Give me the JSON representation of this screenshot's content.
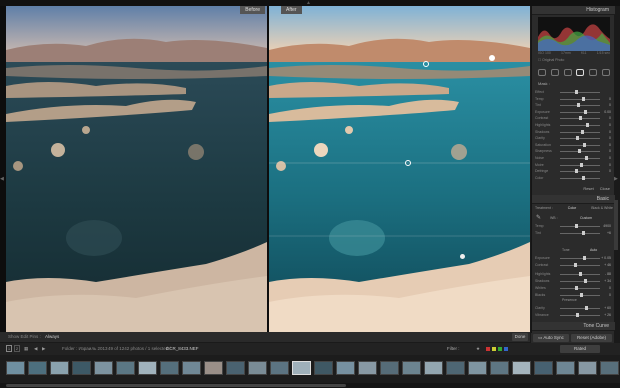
{
  "compare": {
    "before_label": "Before",
    "after_label": "After"
  },
  "panel": {
    "histogram_title": "Histogram",
    "histogram_info": [
      "ISO 100",
      "17mm",
      "f/11",
      "1/15 sec"
    ],
    "original_photo_label": "Original Photo",
    "basic_title": "Basic",
    "treatment": [
      "Treatment :",
      "Color",
      "Black & White"
    ],
    "wb_label": "WB :",
    "wb_value": "Custom",
    "tone_label": "Tone",
    "tone_auto": "Auto",
    "presence_label": "Presence",
    "tone_curve_title": "Tone Curve",
    "mask_title": "Mask :",
    "sliders_top": [
      {
        "label": "Effect",
        "value": ""
      },
      {
        "label": "Temp",
        "value": "0"
      },
      {
        "label": "Tint",
        "value": "0"
      },
      {
        "label": "Exposure",
        "value": "0.00"
      },
      {
        "label": "Contrast",
        "value": "0"
      },
      {
        "label": "Highlights",
        "value": "0"
      },
      {
        "label": "Shadows",
        "value": "0"
      },
      {
        "label": "Clarity",
        "value": "0"
      },
      {
        "label": "Saturation",
        "value": "0"
      },
      {
        "label": "Sharpness",
        "value": "0"
      },
      {
        "label": "Noise",
        "value": "0"
      },
      {
        "label": "Moire",
        "value": "0"
      },
      {
        "label": "Defringe",
        "value": "0"
      },
      {
        "label": "Color",
        "value": ""
      }
    ],
    "sliders_basic": [
      {
        "label": "Temp",
        "value": "4900"
      },
      {
        "label": "Tint",
        "value": "+6"
      },
      {
        "label": "Exposure",
        "value": "+ 0.05"
      },
      {
        "label": "Contrast",
        "value": "+ 46"
      },
      {
        "label": "Highlights",
        "value": "- 88"
      },
      {
        "label": "Shadows",
        "value": "+ 34"
      },
      {
        "label": "Whites",
        "value": "0"
      },
      {
        "label": "Blacks",
        "value": "0"
      },
      {
        "label": "Clarity",
        "value": "+ 60"
      },
      {
        "label": "Vibrance",
        "value": "+ 26"
      },
      {
        "label": "Saturation",
        "value": "0"
      }
    ],
    "reset": "Reset",
    "close": "Close"
  },
  "bottombar": {
    "show_edit_pins": "Show Edit Pins :",
    "pins_value": "Always",
    "done": "Done",
    "previous": "Previous",
    "reset_adobe": "Reset (Adobe)",
    "auto_sync": "Auto Sync"
  },
  "filmstrip": {
    "page_numbers": [
      "1",
      "2"
    ],
    "folder_text": "Folder : Израиль 2013",
    "count_text": "49 of 1242 photos / 1 selected /",
    "filename": "DCR_8433.NEF",
    "filter_label": "Filter :",
    "filter_value": "Rated"
  }
}
